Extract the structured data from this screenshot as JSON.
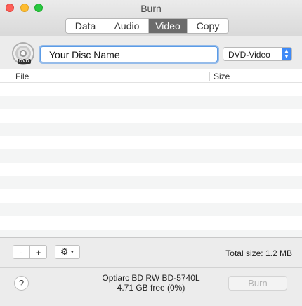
{
  "window": {
    "title": "Burn"
  },
  "tabs": [
    {
      "label": "Data",
      "selected": false
    },
    {
      "label": "Audio",
      "selected": false
    },
    {
      "label": "Video",
      "selected": true
    },
    {
      "label": "Copy",
      "selected": false
    }
  ],
  "disc": {
    "icon": "dvd-disc-icon",
    "badge": "DVD"
  },
  "disc_name": {
    "value": "Your Disc Name"
  },
  "format_popup": {
    "selected": "DVD-Video",
    "arrows": "▲▼"
  },
  "table": {
    "columns": [
      "File",
      "Size"
    ],
    "rows": []
  },
  "toolbar": {
    "remove_label": "-",
    "add_label": "+",
    "gear_icon": "⚙",
    "gear_caret": "▼",
    "total_size": "Total size: 1.2 MB"
  },
  "footer": {
    "help_label": "?",
    "drive_name": "Optiarc BD RW BD-5740L",
    "drive_free": "4.71 GB free (0%)",
    "burn_label": "Burn"
  },
  "colors": {
    "accent": "#3d89f7",
    "selected_tab": "#6c6c6c",
    "close": "#fd5f57",
    "minimize": "#febc2e",
    "maximize": "#28c840"
  }
}
